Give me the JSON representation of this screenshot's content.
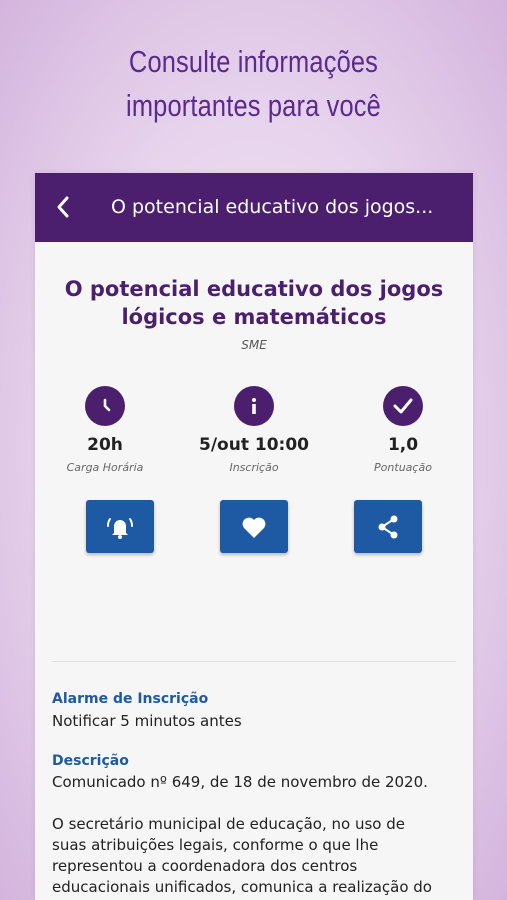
{
  "promo": {
    "line1": "Consulte informações",
    "line2": "importantes para você"
  },
  "appbar": {
    "title": "O potencial educativo dos jogos...",
    "back_icon": "chevron-left-icon"
  },
  "event": {
    "title_line1": "O potencial educativo dos jogos",
    "title_line2": "lógicos e matemáticos",
    "organizer": "SME"
  },
  "stats": [
    {
      "icon": "clock-icon",
      "value": "20h",
      "label": "Carga Horária"
    },
    {
      "icon": "info-icon",
      "value": "5/out 10:00",
      "label": "Inscrição"
    },
    {
      "icon": "check-icon",
      "value": "1,0",
      "label": "Pontuação"
    }
  ],
  "actions": [
    {
      "icon": "alarm-bell-icon"
    },
    {
      "icon": "heart-icon"
    },
    {
      "icon": "share-icon"
    }
  ],
  "alarm": {
    "title": "Alarme de Inscrição",
    "text": "Notificar 5 minutos antes"
  },
  "description": {
    "title": "Descrição",
    "line1": "Comunicado nº 649, de 18 de novembro de 2020.",
    "p2_line1": "O secretário municipal de educação, no uso de",
    "p2_line2": "suas atribuições legais, conforme o que lhe",
    "p2_line3": "representou a coordenadora dos centros",
    "p2_line4": "educacionais unificados, comunica a realização do"
  },
  "colors": {
    "header": "#4b1f6e",
    "accent_blue": "#1d5aa3",
    "title_purple": "#4b1f6e"
  }
}
